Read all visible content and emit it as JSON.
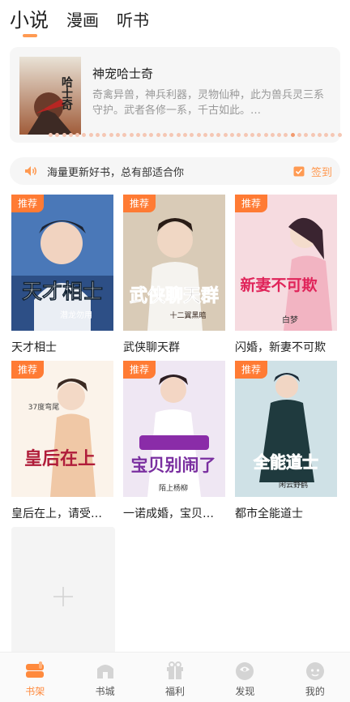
{
  "top_tabs": [
    {
      "label": "小说",
      "active": true
    },
    {
      "label": "漫画",
      "active": false
    },
    {
      "label": "听书",
      "active": false
    }
  ],
  "banner": {
    "title": "神宠哈士奇",
    "description": "奇禽异兽，神兵利器，灵物仙种，此为兽兵灵三系守护。武者各修一系，千古如此。…",
    "cover_text": "哈士奇",
    "dot_count": 44,
    "active_dot": 36
  },
  "notice": {
    "icon": "speaker-icon",
    "text": "海量更新好书，总有部适合你",
    "sign_icon": "checkbox-icon",
    "sign_label": "签到"
  },
  "badge_label": "推荐",
  "books": [
    {
      "title": "天才相士",
      "cover_text": "天才相士",
      "author_line": "潜龙勿用",
      "badge": true
    },
    {
      "title": "武侠聊天群",
      "cover_text": "武侠聊天群",
      "author_line": "十二翼黑暗",
      "badge": true
    },
    {
      "title": "闪婚，新妻不可欺",
      "cover_text": "新妻不可欺",
      "author_line": "白梦",
      "badge": true
    },
    {
      "title": "皇后在上，请受…",
      "cover_text": "皇后在上",
      "author_line": "37度弯尾",
      "badge": true
    },
    {
      "title": "一诺成婚，宝贝…",
      "cover_text": "宝贝别闹了",
      "author_line": "陌上杨柳",
      "badge": true
    },
    {
      "title": "都市全能道士",
      "cover_text": "全能道士",
      "author_line": "闲云野鹤",
      "badge": true
    }
  ],
  "add_card": {
    "icon": "plus-icon"
  },
  "bottom_nav": [
    {
      "label": "书架",
      "icon": "bookshelf-icon",
      "active": true
    },
    {
      "label": "书城",
      "icon": "bookstore-icon",
      "active": false
    },
    {
      "label": "福利",
      "icon": "gift-icon",
      "active": false
    },
    {
      "label": "发现",
      "icon": "discover-icon",
      "active": false
    },
    {
      "label": "我的",
      "icon": "profile-icon",
      "active": false
    }
  ],
  "colors": {
    "accent": "#ff8a3d",
    "badge": "#ff7b34",
    "muted": "#999999"
  }
}
